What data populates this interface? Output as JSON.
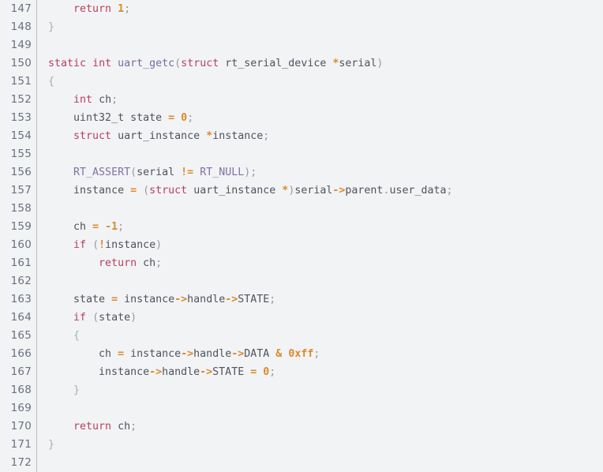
{
  "editor": {
    "name": "code-viewer",
    "language": "C",
    "background_color": "#f2f3f5",
    "gutter_divider_color": "#b9bcc4",
    "line_number_color": "#6a7080",
    "first_line": 147,
    "last_line": 172,
    "colors": {
      "keyword": "#b8405e",
      "macro": "#8070a8",
      "function": "#7a6a9e",
      "identifier": "#50535c",
      "operator": "#d98a2b",
      "number": "#d98a2b",
      "punctuation": "#9499a3",
      "brace": "#a8adb6"
    }
  },
  "lines": [
    {
      "number": "147",
      "text": "    return 1;",
      "tokens": [
        {
          "t": "    ",
          "c": "plain"
        },
        {
          "t": "return",
          "c": "keyword"
        },
        {
          "t": " ",
          "c": "plain"
        },
        {
          "t": "1",
          "c": "num"
        },
        {
          "t": ";",
          "c": "punct"
        }
      ]
    },
    {
      "number": "148",
      "text": "}",
      "tokens": [
        {
          "t": "}",
          "c": "brace"
        }
      ]
    },
    {
      "number": "149",
      "text": "",
      "tokens": []
    },
    {
      "number": "150",
      "text": "static int uart_getc(struct rt_serial_device *serial)",
      "tokens": [
        {
          "t": "static",
          "c": "keyword"
        },
        {
          "t": " ",
          "c": "plain"
        },
        {
          "t": "int",
          "c": "keyword"
        },
        {
          "t": " ",
          "c": "plain"
        },
        {
          "t": "uart_getc",
          "c": "func"
        },
        {
          "t": "(",
          "c": "punct"
        },
        {
          "t": "struct",
          "c": "keyword"
        },
        {
          "t": " ",
          "c": "plain"
        },
        {
          "t": "rt_serial_device",
          "c": "type"
        },
        {
          "t": " ",
          "c": "plain"
        },
        {
          "t": "*",
          "c": "op"
        },
        {
          "t": "serial",
          "c": "ident"
        },
        {
          "t": ")",
          "c": "punct"
        }
      ]
    },
    {
      "number": "151",
      "text": "{",
      "tokens": [
        {
          "t": "{",
          "c": "brace"
        }
      ]
    },
    {
      "number": "152",
      "text": "    int ch;",
      "tokens": [
        {
          "t": "    ",
          "c": "plain"
        },
        {
          "t": "int",
          "c": "keyword"
        },
        {
          "t": " ",
          "c": "plain"
        },
        {
          "t": "ch",
          "c": "ident"
        },
        {
          "t": ";",
          "c": "punct"
        }
      ]
    },
    {
      "number": "153",
      "text": "    uint32_t state = 0;",
      "tokens": [
        {
          "t": "    ",
          "c": "plain"
        },
        {
          "t": "uint32_t",
          "c": "type"
        },
        {
          "t": " ",
          "c": "plain"
        },
        {
          "t": "state",
          "c": "ident"
        },
        {
          "t": " ",
          "c": "plain"
        },
        {
          "t": "=",
          "c": "op"
        },
        {
          "t": " ",
          "c": "plain"
        },
        {
          "t": "0",
          "c": "num"
        },
        {
          "t": ";",
          "c": "punct"
        }
      ]
    },
    {
      "number": "154",
      "text": "    struct uart_instance *instance;",
      "tokens": [
        {
          "t": "    ",
          "c": "plain"
        },
        {
          "t": "struct",
          "c": "keyword"
        },
        {
          "t": " ",
          "c": "plain"
        },
        {
          "t": "uart_instance",
          "c": "type"
        },
        {
          "t": " ",
          "c": "plain"
        },
        {
          "t": "*",
          "c": "op"
        },
        {
          "t": "instance",
          "c": "ident"
        },
        {
          "t": ";",
          "c": "punct"
        }
      ]
    },
    {
      "number": "155",
      "text": "",
      "tokens": []
    },
    {
      "number": "156",
      "text": "    RT_ASSERT(serial != RT_NULL);",
      "tokens": [
        {
          "t": "    ",
          "c": "plain"
        },
        {
          "t": "RT_ASSERT",
          "c": "macro"
        },
        {
          "t": "(",
          "c": "punct"
        },
        {
          "t": "serial",
          "c": "ident"
        },
        {
          "t": " ",
          "c": "plain"
        },
        {
          "t": "!=",
          "c": "op"
        },
        {
          "t": " ",
          "c": "plain"
        },
        {
          "t": "RT_NULL",
          "c": "macro"
        },
        {
          "t": ")",
          "c": "punct"
        },
        {
          "t": ";",
          "c": "punct"
        }
      ]
    },
    {
      "number": "157",
      "text": "    instance = (struct uart_instance *)serial->parent.user_data;",
      "tokens": [
        {
          "t": "    ",
          "c": "plain"
        },
        {
          "t": "instance",
          "c": "ident"
        },
        {
          "t": " ",
          "c": "plain"
        },
        {
          "t": "=",
          "c": "op"
        },
        {
          "t": " ",
          "c": "plain"
        },
        {
          "t": "(",
          "c": "punct"
        },
        {
          "t": "struct",
          "c": "keyword"
        },
        {
          "t": " ",
          "c": "plain"
        },
        {
          "t": "uart_instance",
          "c": "type"
        },
        {
          "t": " ",
          "c": "plain"
        },
        {
          "t": "*",
          "c": "op"
        },
        {
          "t": ")",
          "c": "punct"
        },
        {
          "t": "serial",
          "c": "ident"
        },
        {
          "t": "->",
          "c": "op"
        },
        {
          "t": "parent",
          "c": "ident"
        },
        {
          "t": ".",
          "c": "punct"
        },
        {
          "t": "user_data",
          "c": "ident"
        },
        {
          "t": ";",
          "c": "punct"
        }
      ]
    },
    {
      "number": "158",
      "text": "",
      "tokens": []
    },
    {
      "number": "159",
      "text": "    ch = -1;",
      "tokens": [
        {
          "t": "    ",
          "c": "plain"
        },
        {
          "t": "ch",
          "c": "ident"
        },
        {
          "t": " ",
          "c": "plain"
        },
        {
          "t": "=",
          "c": "op"
        },
        {
          "t": " ",
          "c": "plain"
        },
        {
          "t": "-",
          "c": "op"
        },
        {
          "t": "1",
          "c": "num"
        },
        {
          "t": ";",
          "c": "punct"
        }
      ]
    },
    {
      "number": "160",
      "text": "    if (!instance)",
      "tokens": [
        {
          "t": "    ",
          "c": "plain"
        },
        {
          "t": "if",
          "c": "keyword"
        },
        {
          "t": " ",
          "c": "plain"
        },
        {
          "t": "(",
          "c": "punct"
        },
        {
          "t": "!",
          "c": "op"
        },
        {
          "t": "instance",
          "c": "ident"
        },
        {
          "t": ")",
          "c": "punct"
        }
      ]
    },
    {
      "number": "161",
      "text": "        return ch;",
      "tokens": [
        {
          "t": "        ",
          "c": "plain"
        },
        {
          "t": "return",
          "c": "keyword"
        },
        {
          "t": " ",
          "c": "plain"
        },
        {
          "t": "ch",
          "c": "ident"
        },
        {
          "t": ";",
          "c": "punct"
        }
      ]
    },
    {
      "number": "162",
      "text": "",
      "tokens": []
    },
    {
      "number": "163",
      "text": "    state = instance->handle->STATE;",
      "tokens": [
        {
          "t": "    ",
          "c": "plain"
        },
        {
          "t": "state",
          "c": "ident"
        },
        {
          "t": " ",
          "c": "plain"
        },
        {
          "t": "=",
          "c": "op"
        },
        {
          "t": " ",
          "c": "plain"
        },
        {
          "t": "instance",
          "c": "ident"
        },
        {
          "t": "->",
          "c": "op"
        },
        {
          "t": "handle",
          "c": "ident"
        },
        {
          "t": "->",
          "c": "op"
        },
        {
          "t": "STATE",
          "c": "ident"
        },
        {
          "t": ";",
          "c": "punct"
        }
      ]
    },
    {
      "number": "164",
      "text": "    if (state)",
      "tokens": [
        {
          "t": "    ",
          "c": "plain"
        },
        {
          "t": "if",
          "c": "keyword"
        },
        {
          "t": " ",
          "c": "plain"
        },
        {
          "t": "(",
          "c": "punct"
        },
        {
          "t": "state",
          "c": "ident"
        },
        {
          "t": ")",
          "c": "punct"
        }
      ]
    },
    {
      "number": "165",
      "text": "    {",
      "tokens": [
        {
          "t": "    ",
          "c": "plain"
        },
        {
          "t": "{",
          "c": "brace"
        }
      ]
    },
    {
      "number": "166",
      "text": "        ch = instance->handle->DATA & 0xff;",
      "tokens": [
        {
          "t": "        ",
          "c": "plain"
        },
        {
          "t": "ch",
          "c": "ident"
        },
        {
          "t": " ",
          "c": "plain"
        },
        {
          "t": "=",
          "c": "op"
        },
        {
          "t": " ",
          "c": "plain"
        },
        {
          "t": "instance",
          "c": "ident"
        },
        {
          "t": "->",
          "c": "op"
        },
        {
          "t": "handle",
          "c": "ident"
        },
        {
          "t": "->",
          "c": "op"
        },
        {
          "t": "DATA",
          "c": "ident"
        },
        {
          "t": " ",
          "c": "plain"
        },
        {
          "t": "&",
          "c": "op"
        },
        {
          "t": " ",
          "c": "plain"
        },
        {
          "t": "0xff",
          "c": "num"
        },
        {
          "t": ";",
          "c": "punct"
        }
      ]
    },
    {
      "number": "167",
      "text": "        instance->handle->STATE = 0;",
      "tokens": [
        {
          "t": "        ",
          "c": "plain"
        },
        {
          "t": "instance",
          "c": "ident"
        },
        {
          "t": "->",
          "c": "op"
        },
        {
          "t": "handle",
          "c": "ident"
        },
        {
          "t": "->",
          "c": "op"
        },
        {
          "t": "STATE",
          "c": "ident"
        },
        {
          "t": " ",
          "c": "plain"
        },
        {
          "t": "=",
          "c": "op"
        },
        {
          "t": " ",
          "c": "plain"
        },
        {
          "t": "0",
          "c": "num"
        },
        {
          "t": ";",
          "c": "punct"
        }
      ]
    },
    {
      "number": "168",
      "text": "    }",
      "tokens": [
        {
          "t": "    ",
          "c": "plain"
        },
        {
          "t": "}",
          "c": "brace"
        }
      ]
    },
    {
      "number": "169",
      "text": "",
      "tokens": []
    },
    {
      "number": "170",
      "text": "    return ch;",
      "tokens": [
        {
          "t": "    ",
          "c": "plain"
        },
        {
          "t": "return",
          "c": "keyword"
        },
        {
          "t": " ",
          "c": "plain"
        },
        {
          "t": "ch",
          "c": "ident"
        },
        {
          "t": ";",
          "c": "punct"
        }
      ]
    },
    {
      "number": "171",
      "text": "}",
      "tokens": [
        {
          "t": "}",
          "c": "brace"
        }
      ]
    },
    {
      "number": "172",
      "text": "",
      "tokens": []
    }
  ]
}
